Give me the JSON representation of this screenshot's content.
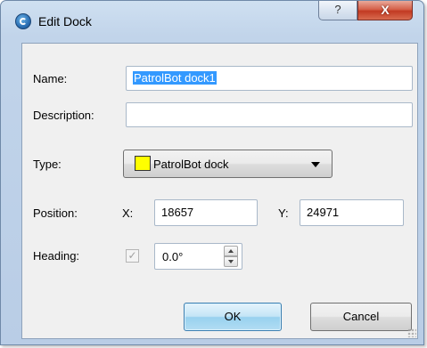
{
  "window": {
    "title": "Edit Dock",
    "help_label": "?",
    "close_label": "X"
  },
  "form": {
    "name_label": "Name:",
    "name_value": "PatrolBot dock1",
    "description_label": "Description:",
    "description_value": "",
    "type_label": "Type:",
    "type_value": "PatrolBot dock",
    "type_swatch_color": "#ffff00",
    "position_label": "Position:",
    "x_label": "X:",
    "x_value": "18657",
    "y_label": "Y:",
    "y_value": "24971",
    "heading_label": "Heading:",
    "heading_checked": true,
    "heading_check_glyph": "✓",
    "heading_value": "0.0°"
  },
  "buttons": {
    "ok_label": "OK",
    "cancel_label": "Cancel"
  }
}
